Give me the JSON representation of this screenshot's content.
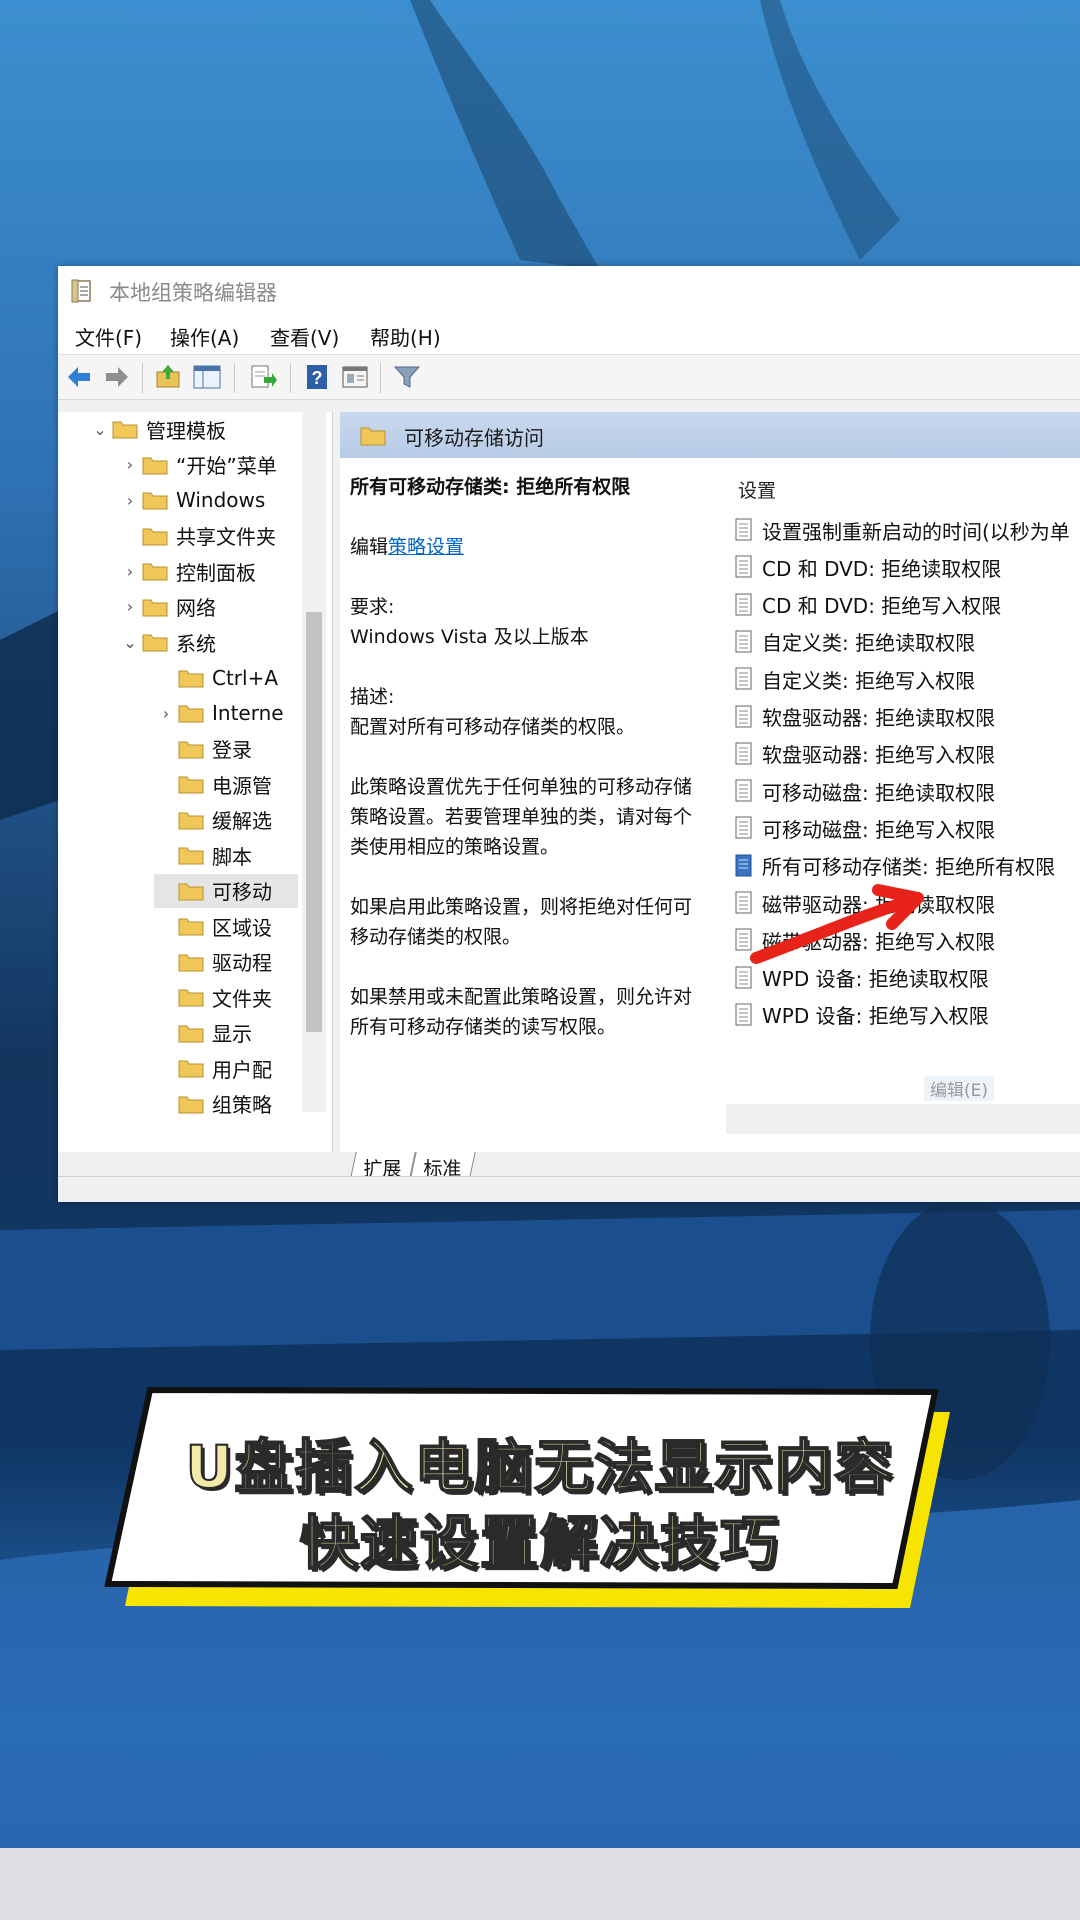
{
  "window": {
    "title": "本地组策略编辑器",
    "menu": [
      "文件(F)",
      "操作(A)",
      "查看(V)",
      "帮助(H)"
    ]
  },
  "toolbar": {
    "icons": [
      "back-icon",
      "forward-icon",
      "up-folder-icon",
      "show-hide-tree-icon",
      "export-list-icon",
      "help-icon",
      "properties-icon",
      "filter-icon"
    ]
  },
  "tree": {
    "items": [
      {
        "label": "管理模板",
        "level": 0,
        "chev": "⌄"
      },
      {
        "label": "“开始”菜单",
        "level": 1,
        "chev": "›"
      },
      {
        "label": "Windows",
        "level": 1,
        "chev": "›"
      },
      {
        "label": "共享文件夹",
        "level": 1,
        "chev": ""
      },
      {
        "label": "控制面板",
        "level": 1,
        "chev": "›"
      },
      {
        "label": "网络",
        "level": 1,
        "chev": "›"
      },
      {
        "label": "系统",
        "level": 1,
        "chev": "⌄"
      },
      {
        "label": "Ctrl+A",
        "level": 2,
        "chev": ""
      },
      {
        "label": "Interne",
        "level": 2,
        "chev": "›"
      },
      {
        "label": "登录",
        "level": 2,
        "chev": ""
      },
      {
        "label": "电源管",
        "level": 2,
        "chev": ""
      },
      {
        "label": "缓解选",
        "level": 2,
        "chev": ""
      },
      {
        "label": "脚本",
        "level": 2,
        "chev": ""
      },
      {
        "label": "可移动",
        "level": 2,
        "chev": "",
        "selected": true
      },
      {
        "label": "区域设",
        "level": 2,
        "chev": ""
      },
      {
        "label": "驱动程",
        "level": 2,
        "chev": ""
      },
      {
        "label": "文件夹",
        "level": 2,
        "chev": ""
      },
      {
        "label": "显示",
        "level": 2,
        "chev": ""
      },
      {
        "label": "用户配",
        "level": 2,
        "chev": ""
      },
      {
        "label": "组策略",
        "level": 2,
        "chev": ""
      }
    ]
  },
  "right": {
    "header": "可移动存储访问",
    "policy_title": "所有可移动存储类: 拒绝所有权限",
    "edit_prefix": "编辑",
    "edit_link": "策略设置",
    "requirements_label": "要求:",
    "requirements": "Windows Vista 及以上版本",
    "description_label": "描述:",
    "description": "配置对所有可移动存储类的权限。",
    "para1": "此策略设置优先于任何单独的可移动存储策略设置。若要管理单独的类，请对每个类使用相应的策略设置。",
    "para2": "如果启用此策略设置，则将拒绝对任何可移动存储类的权限。",
    "para3": "如果禁用或未配置此策略设置，则允许对所有可移动存储类的读写权限。",
    "settings_header": "设置",
    "settings": [
      "设置强制重新启动的时间(以秒为单",
      "CD 和 DVD: 拒绝读取权限",
      "CD 和 DVD: 拒绝写入权限",
      "自定义类: 拒绝读取权限",
      "自定义类: 拒绝写入权限",
      "软盘驱动器: 拒绝读取权限",
      "软盘驱动器: 拒绝写入权限",
      "可移动磁盘: 拒绝读取权限",
      "可移动磁盘: 拒绝写入权限",
      "所有可移动存储类: 拒绝所有权限",
      "磁带驱动器: 拒绝读取权限",
      "磁带驱动器: 拒绝写入权限",
      "WPD 设备: 拒绝读取权限",
      "WPD 设备: 拒绝写入权限"
    ],
    "selected_index": 9,
    "context_hint": "编辑(E)",
    "tabs": [
      "扩展",
      "标准"
    ]
  },
  "banner": {
    "line1": "U盘插入电脑无法显示内容",
    "line2": "快速设置解决技巧"
  },
  "colors": {
    "header_blue": "#c3d5ec",
    "link": "#0066cc",
    "banner_text": "#f3e9a8",
    "banner_accent": "#f7e400",
    "arrow_red": "#e8231a"
  }
}
